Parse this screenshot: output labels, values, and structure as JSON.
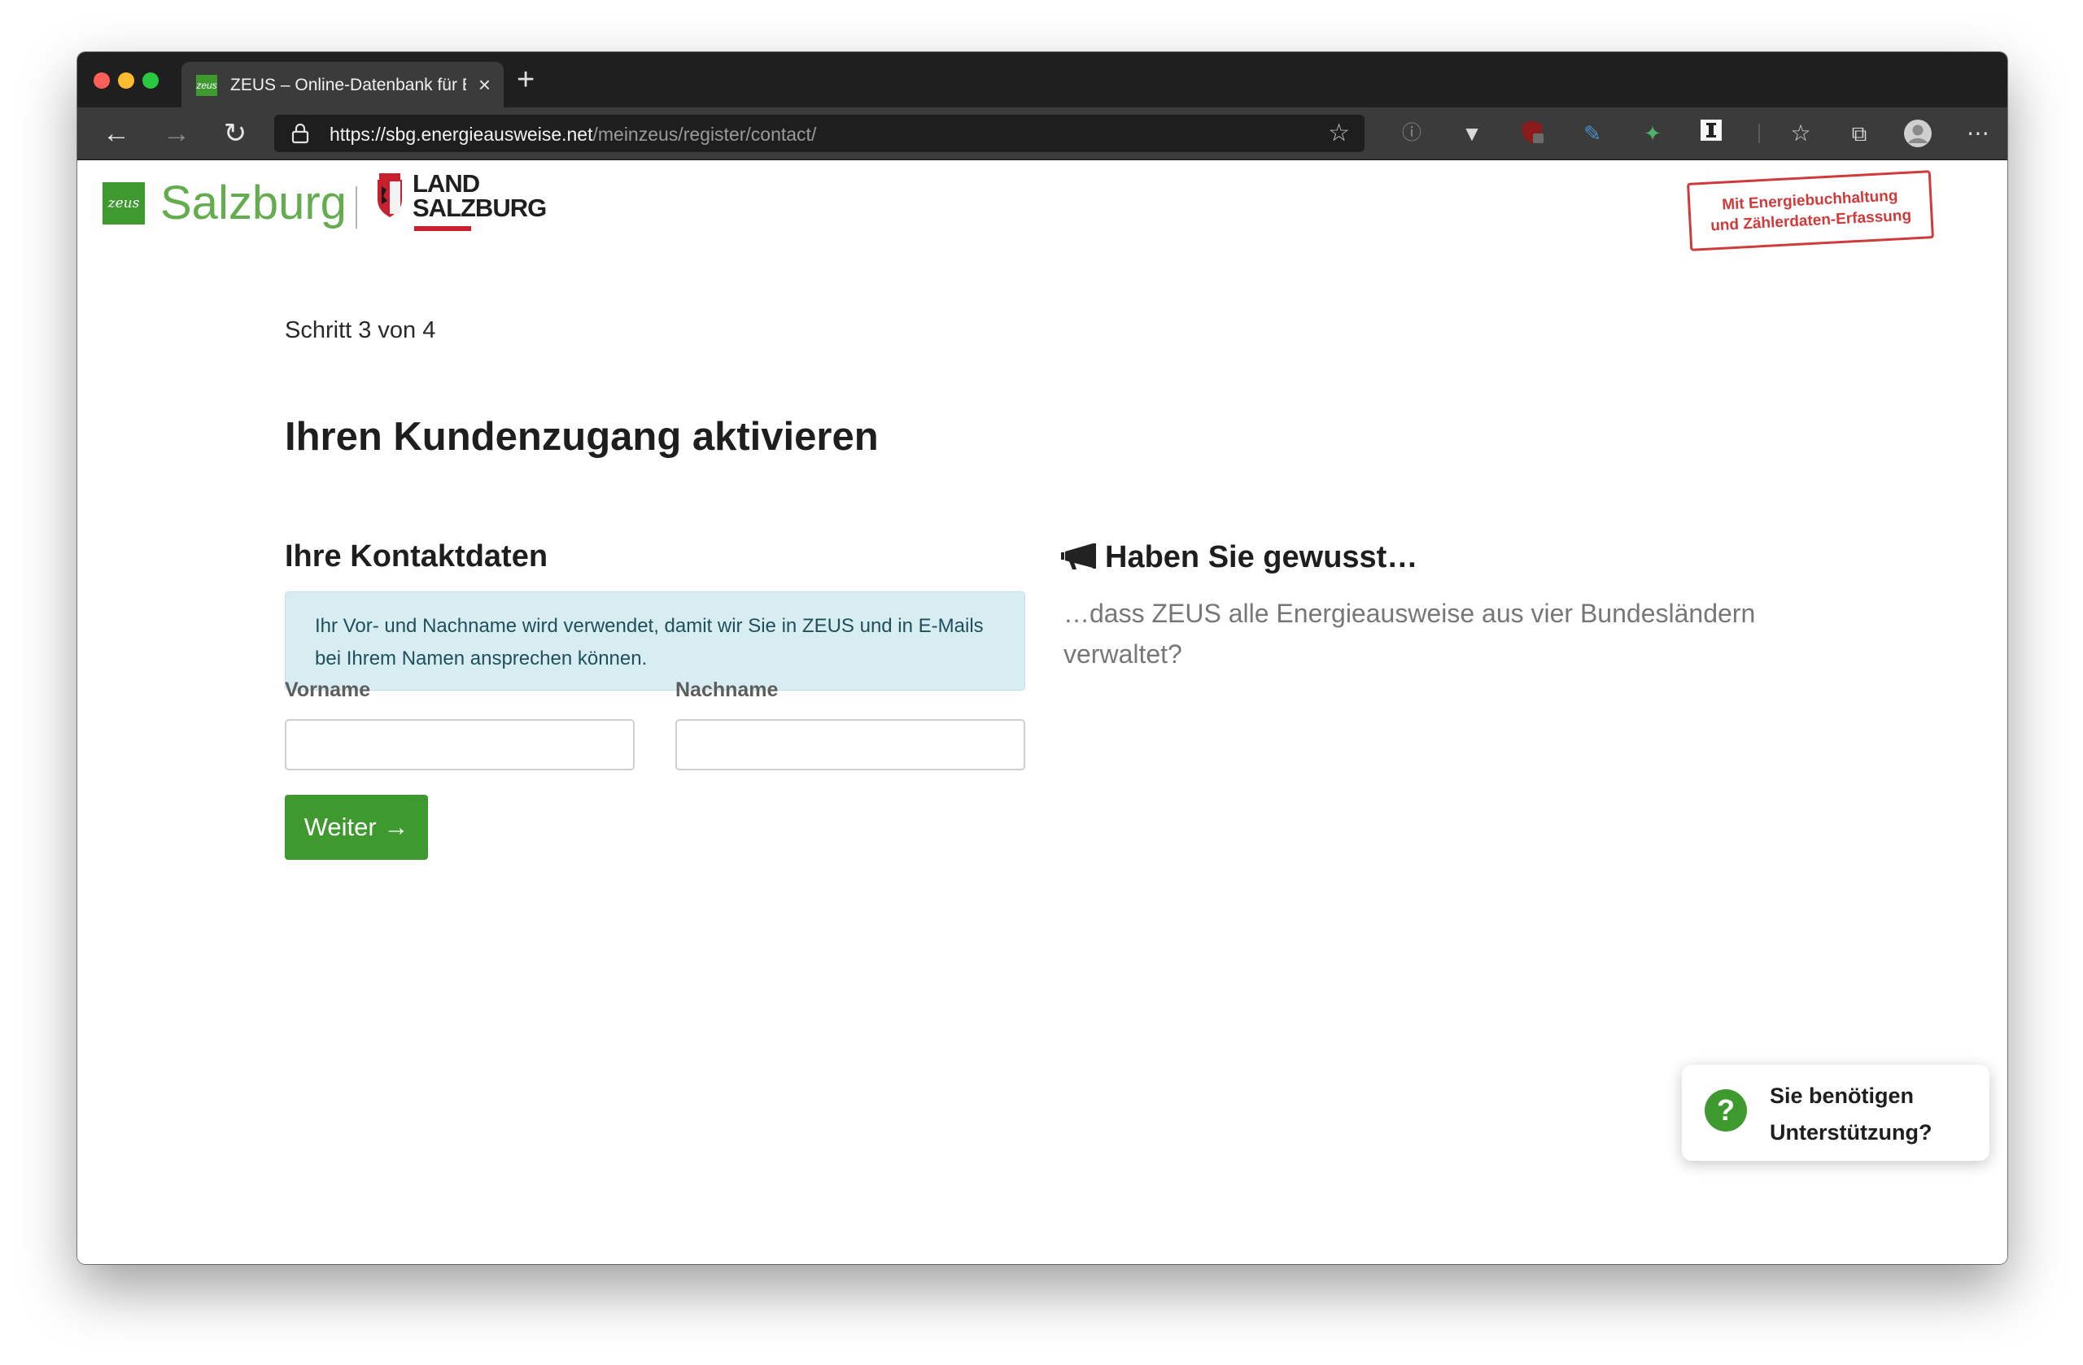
{
  "browser": {
    "tab_title": "ZEUS – Online-Datenbank für Energieausweise",
    "url_host": "https://sbg.energieausweise.net",
    "url_path": "/meinzeus/register/contact/"
  },
  "brand": {
    "site_name": "Salzburg",
    "favicon_text": "zeus",
    "land_line1": "LAND",
    "land_line2": "SALZBURG",
    "stamp_line1": "Mit Energiebuchhaltung",
    "stamp_line2": "und Zählerdaten-Erfassung",
    "green": "#3e9a2f",
    "stamp_red": "#cf3b3b"
  },
  "page": {
    "step": "Schritt 3 von 4",
    "title": "Ihren Kundenzugang aktivieren"
  },
  "form": {
    "section_title": "Ihre Kontaktdaten",
    "info": "Ihr Vor- und Nachname wird verwendet, damit wir Sie in ZEUS und in E-Mails bei Ihrem Namen ansprechen können.",
    "first_name_label": "Vorname",
    "first_name_value": "",
    "last_name_label": "Nachname",
    "last_name_value": "",
    "submit_label": "Weiter →"
  },
  "did_you_know": {
    "title": "Haben Sie gewusst…",
    "text": "…dass ZEUS alle Energieausweise aus vier Bundesländern verwaltet?"
  },
  "support": {
    "line1": "Sie benötigen",
    "line2": "Unterstützung?"
  }
}
